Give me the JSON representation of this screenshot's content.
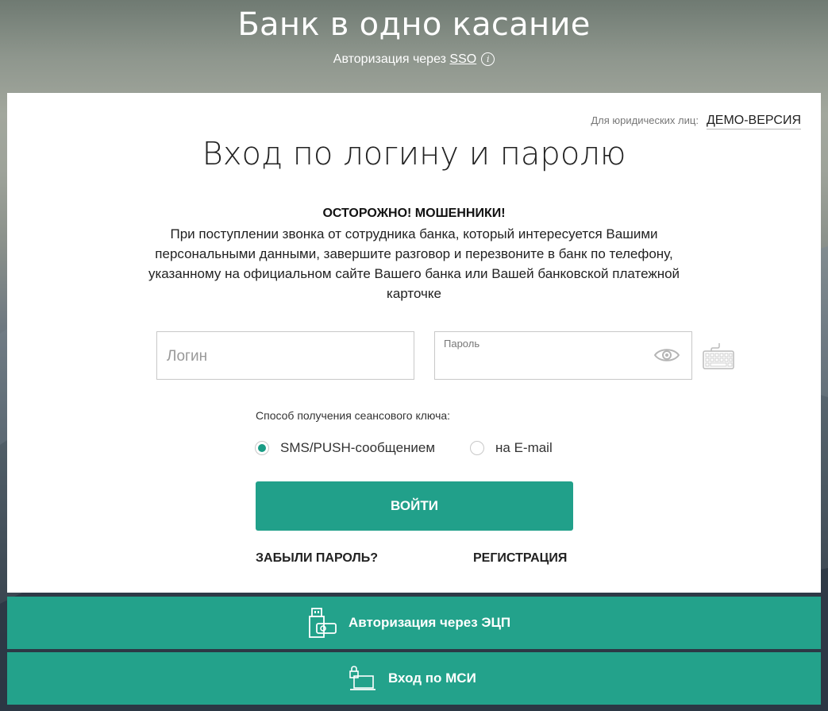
{
  "header": {
    "title": "Банк в одно касание",
    "subtitle_prefix": "Авторизация через ",
    "subtitle_link": "SSO",
    "info_icon": "i"
  },
  "card": {
    "legal_label": "Для юридических лиц:",
    "demo_link": "ДЕМО-ВЕРСИЯ",
    "heading": "Вход по логину и паролю",
    "warning_title": "ОСТОРОЖНО! МОШЕННИКИ!",
    "warning_body": "При поступлении звонка от сотрудника банка, который интересуется Вашими персональными данными, завершите разговор и перезвоните в банк по телефону, указанному на официальном сайте Вашего банка или Вашей банковской платежной карточке"
  },
  "form": {
    "login_placeholder": "Логин",
    "login_value": "",
    "password_label": "Пароль",
    "password_value": "",
    "session_key_label": "Способ получения сеансового ключа:",
    "options": [
      {
        "label": "SMS/PUSH-сообщением",
        "selected": true
      },
      {
        "label": "на E-mail",
        "selected": false
      }
    ],
    "submit_label": "ВОЙТИ",
    "forgot_label": "ЗАБЫЛИ ПАРОЛЬ?",
    "register_label": "РЕГИСТРАЦИЯ"
  },
  "alt_auth": {
    "ecp_label": "Авторизация через ЭЦП",
    "msi_label": "Вход по МСИ"
  },
  "colors": {
    "accent": "#21a08a",
    "bar": "#23a28b",
    "text": "#222222"
  },
  "icons": {
    "eye": "eye-icon",
    "keyboard": "keyboard-icon",
    "usb_token": "usb-token-icon",
    "msi": "lock-laptop-icon"
  }
}
